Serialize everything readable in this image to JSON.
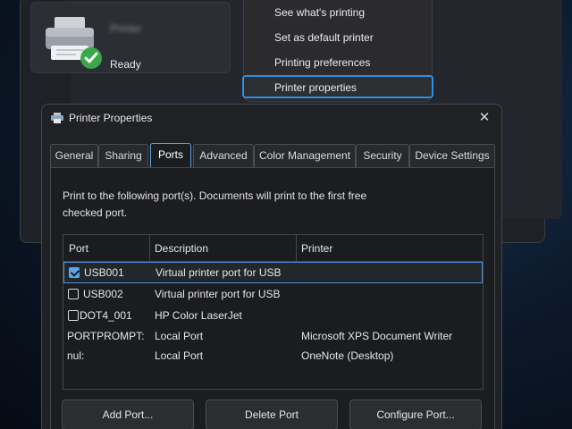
{
  "printer_card": {
    "name": "Printer",
    "status": "Ready"
  },
  "context_menu": {
    "items": [
      {
        "label": "See what's printing"
      },
      {
        "label": "Set as default printer"
      },
      {
        "label": "Printing preferences"
      },
      {
        "label": "Printer properties",
        "selected": true
      }
    ]
  },
  "dialog": {
    "title": "Printer Properties",
    "close_glyph": "✕",
    "tabs": [
      {
        "label": "General"
      },
      {
        "label": "Sharing"
      },
      {
        "label": "Ports",
        "active": true
      },
      {
        "label": "Advanced"
      },
      {
        "label": "Color Management"
      },
      {
        "label": "Security"
      },
      {
        "label": "Device Settings"
      }
    ],
    "instructions": "Print to the following port(s). Documents will print to the first free checked port.",
    "table": {
      "headers": [
        "Port",
        "Description",
        "Printer"
      ],
      "rows": [
        {
          "port": "USB001",
          "description": "Virtual printer port for USB",
          "printer": "",
          "checked": true,
          "selected": true
        },
        {
          "port": "USB002",
          "description": "Virtual printer port for USB",
          "printer": "",
          "checked": false
        },
        {
          "port": "DOT4_001",
          "description": "HP Color LaserJet",
          "printer": "",
          "checked": false
        },
        {
          "port": "PORTPROMPT:",
          "description": "Local Port",
          "printer": "Microsoft XPS Document Writer"
        },
        {
          "port": "nul:",
          "description": "Local Port",
          "printer": "OneNote (Desktop)"
        }
      ]
    },
    "buttons": {
      "add_port": "Add Port...",
      "delete_port": "Delete Port",
      "configure_port": "Configure Port..."
    }
  },
  "colors": {
    "accent": "#2f8fe0",
    "check": "#5ea4ec",
    "status_ok": "#3aa84a"
  }
}
